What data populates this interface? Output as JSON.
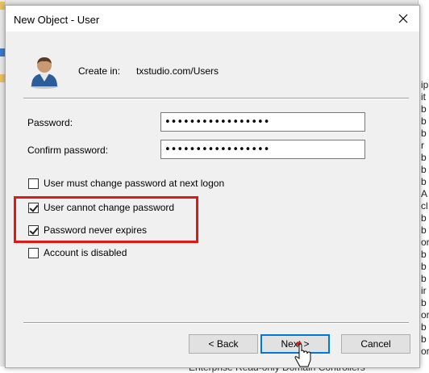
{
  "dialog": {
    "title": "New Object - User",
    "create_in_label": "Create in:",
    "create_in_path": "txstudio.com/Users"
  },
  "password": {
    "label": "Password:",
    "value": "•••••••••••••••••",
    "confirm_label": "Confirm password:",
    "confirm_value": "•••••••••••••••••"
  },
  "options": [
    {
      "label": "User must change password at next logon",
      "checked": false
    },
    {
      "label": "User cannot change password",
      "checked": true
    },
    {
      "label": "Password never expires",
      "checked": true
    },
    {
      "label": "Account is disabled",
      "checked": false
    }
  ],
  "buttons": {
    "back": "< Back",
    "next": "Next >",
    "cancel": "Cancel"
  },
  "colors": {
    "highlight": "#e01818",
    "default_button_border": "#0078d7"
  },
  "background": {
    "right_fragments": [
      "ip",
      "it",
      "b",
      "b",
      "b",
      "r",
      "b",
      "b",
      "b",
      "A",
      "cl",
      "b",
      "b",
      "or",
      "b",
      "b",
      "b",
      "ir",
      "b",
      "or",
      "b",
      "b",
      "or"
    ],
    "bottom_fragment": "Enterprise Read-only Domain Controllers"
  }
}
